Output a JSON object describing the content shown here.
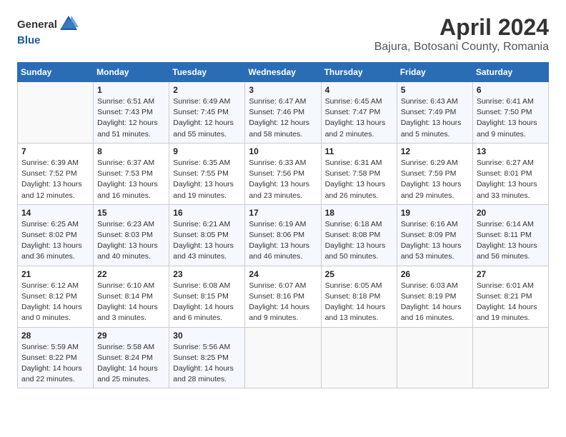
{
  "header": {
    "logo_general": "General",
    "logo_blue": "Blue",
    "title": "April 2024",
    "subtitle": "Bajura, Botosani County, Romania"
  },
  "columns": [
    "Sunday",
    "Monday",
    "Tuesday",
    "Wednesday",
    "Thursday",
    "Friday",
    "Saturday"
  ],
  "weeks": [
    [
      {
        "day": "",
        "detail": ""
      },
      {
        "day": "1",
        "detail": "Sunrise: 6:51 AM\nSunset: 7:43 PM\nDaylight: 12 hours\nand 51 minutes."
      },
      {
        "day": "2",
        "detail": "Sunrise: 6:49 AM\nSunset: 7:45 PM\nDaylight: 12 hours\nand 55 minutes."
      },
      {
        "day": "3",
        "detail": "Sunrise: 6:47 AM\nSunset: 7:46 PM\nDaylight: 12 hours\nand 58 minutes."
      },
      {
        "day": "4",
        "detail": "Sunrise: 6:45 AM\nSunset: 7:47 PM\nDaylight: 13 hours\nand 2 minutes."
      },
      {
        "day": "5",
        "detail": "Sunrise: 6:43 AM\nSunset: 7:49 PM\nDaylight: 13 hours\nand 5 minutes."
      },
      {
        "day": "6",
        "detail": "Sunrise: 6:41 AM\nSunset: 7:50 PM\nDaylight: 13 hours\nand 9 minutes."
      }
    ],
    [
      {
        "day": "7",
        "detail": "Sunrise: 6:39 AM\nSunset: 7:52 PM\nDaylight: 13 hours\nand 12 minutes."
      },
      {
        "day": "8",
        "detail": "Sunrise: 6:37 AM\nSunset: 7:53 PM\nDaylight: 13 hours\nand 16 minutes."
      },
      {
        "day": "9",
        "detail": "Sunrise: 6:35 AM\nSunset: 7:55 PM\nDaylight: 13 hours\nand 19 minutes."
      },
      {
        "day": "10",
        "detail": "Sunrise: 6:33 AM\nSunset: 7:56 PM\nDaylight: 13 hours\nand 23 minutes."
      },
      {
        "day": "11",
        "detail": "Sunrise: 6:31 AM\nSunset: 7:58 PM\nDaylight: 13 hours\nand 26 minutes."
      },
      {
        "day": "12",
        "detail": "Sunrise: 6:29 AM\nSunset: 7:59 PM\nDaylight: 13 hours\nand 29 minutes."
      },
      {
        "day": "13",
        "detail": "Sunrise: 6:27 AM\nSunset: 8:01 PM\nDaylight: 13 hours\nand 33 minutes."
      }
    ],
    [
      {
        "day": "14",
        "detail": "Sunrise: 6:25 AM\nSunset: 8:02 PM\nDaylight: 13 hours\nand 36 minutes."
      },
      {
        "day": "15",
        "detail": "Sunrise: 6:23 AM\nSunset: 8:03 PM\nDaylight: 13 hours\nand 40 minutes."
      },
      {
        "day": "16",
        "detail": "Sunrise: 6:21 AM\nSunset: 8:05 PM\nDaylight: 13 hours\nand 43 minutes."
      },
      {
        "day": "17",
        "detail": "Sunrise: 6:19 AM\nSunset: 8:06 PM\nDaylight: 13 hours\nand 46 minutes."
      },
      {
        "day": "18",
        "detail": "Sunrise: 6:18 AM\nSunset: 8:08 PM\nDaylight: 13 hours\nand 50 minutes."
      },
      {
        "day": "19",
        "detail": "Sunrise: 6:16 AM\nSunset: 8:09 PM\nDaylight: 13 hours\nand 53 minutes."
      },
      {
        "day": "20",
        "detail": "Sunrise: 6:14 AM\nSunset: 8:11 PM\nDaylight: 13 hours\nand 56 minutes."
      }
    ],
    [
      {
        "day": "21",
        "detail": "Sunrise: 6:12 AM\nSunset: 8:12 PM\nDaylight: 14 hours\nand 0 minutes."
      },
      {
        "day": "22",
        "detail": "Sunrise: 6:10 AM\nSunset: 8:14 PM\nDaylight: 14 hours\nand 3 minutes."
      },
      {
        "day": "23",
        "detail": "Sunrise: 6:08 AM\nSunset: 8:15 PM\nDaylight: 14 hours\nand 6 minutes."
      },
      {
        "day": "24",
        "detail": "Sunrise: 6:07 AM\nSunset: 8:16 PM\nDaylight: 14 hours\nand 9 minutes."
      },
      {
        "day": "25",
        "detail": "Sunrise: 6:05 AM\nSunset: 8:18 PM\nDaylight: 14 hours\nand 13 minutes."
      },
      {
        "day": "26",
        "detail": "Sunrise: 6:03 AM\nSunset: 8:19 PM\nDaylight: 14 hours\nand 16 minutes."
      },
      {
        "day": "27",
        "detail": "Sunrise: 6:01 AM\nSunset: 8:21 PM\nDaylight: 14 hours\nand 19 minutes."
      }
    ],
    [
      {
        "day": "28",
        "detail": "Sunrise: 5:59 AM\nSunset: 8:22 PM\nDaylight: 14 hours\nand 22 minutes."
      },
      {
        "day": "29",
        "detail": "Sunrise: 5:58 AM\nSunset: 8:24 PM\nDaylight: 14 hours\nand 25 minutes."
      },
      {
        "day": "30",
        "detail": "Sunrise: 5:56 AM\nSunset: 8:25 PM\nDaylight: 14 hours\nand 28 minutes."
      },
      {
        "day": "",
        "detail": ""
      },
      {
        "day": "",
        "detail": ""
      },
      {
        "day": "",
        "detail": ""
      },
      {
        "day": "",
        "detail": ""
      }
    ]
  ]
}
